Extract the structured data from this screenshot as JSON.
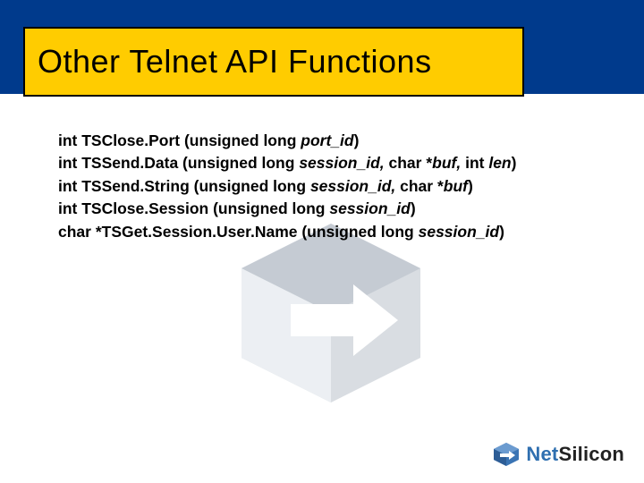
{
  "title": "Other Telnet API Functions",
  "functions": [
    {
      "plain": "int TSClose.Port (unsigned long ",
      "ital": "port_id",
      "tail": ")"
    },
    {
      "plain": "int TSSend.Data (unsigned long ",
      "ital": "session_id,",
      "tail3": " char *",
      "ital2": "buf,",
      "tail4": " int ",
      "ital3": "len",
      "tail5": ")"
    },
    {
      "plain": "int TSSend.String (unsigned long ",
      "ital": "session_id,",
      "tail3": " char *",
      "ital2": "buf",
      "tail5": ")"
    },
    {
      "plain": "int TSClose.Session (unsigned long ",
      "ital": "session_id",
      "tail": ")"
    },
    {
      "plain": "char *TSGet.Session.User.Name (unsigned long ",
      "ital": "session_id",
      "tail": ")"
    }
  ],
  "logo": {
    "net": "Net",
    "silicon": "Silicon"
  }
}
